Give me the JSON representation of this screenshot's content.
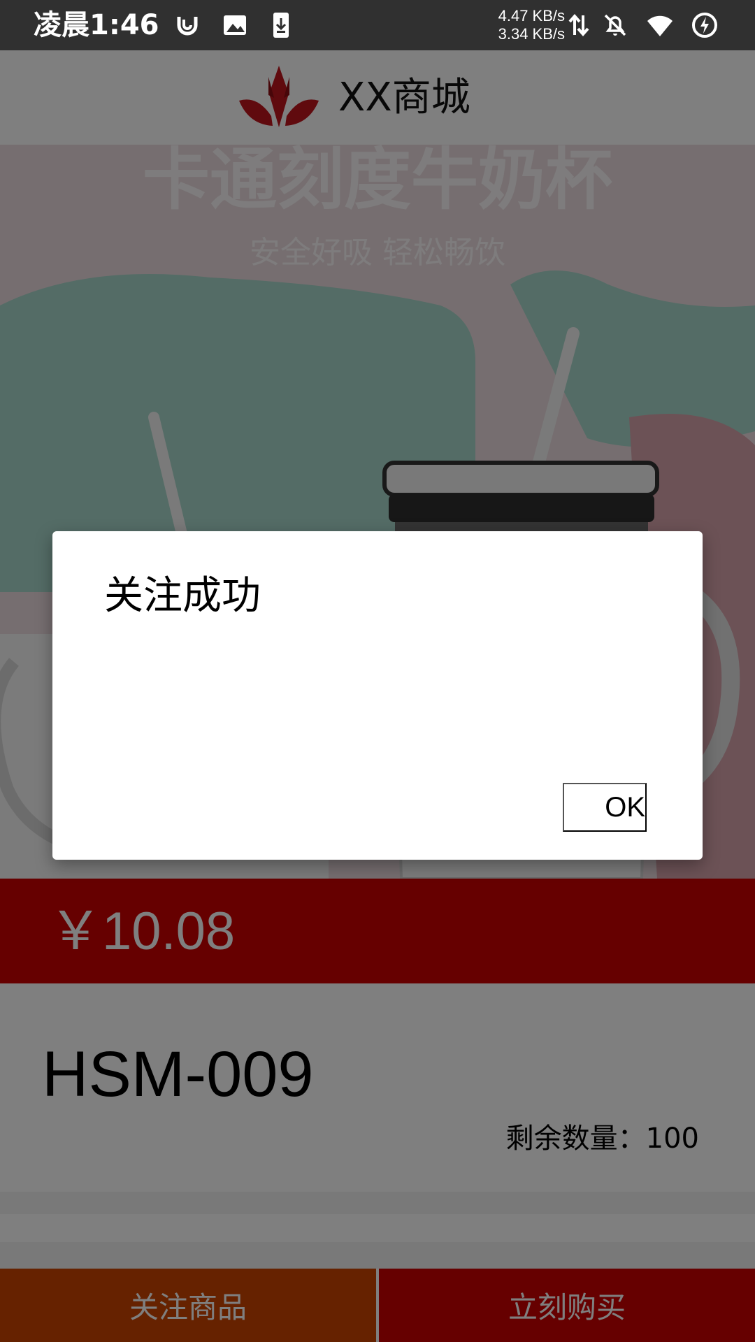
{
  "status_bar": {
    "time": "凌晨1:46",
    "net_speed_up": "4.47 KB/s",
    "net_speed_down": "3.34 KB/s",
    "icons": [
      "notification-app-icon",
      "gallery-icon",
      "download-icon",
      "data-transfer-icon",
      "bell-off-icon",
      "wifi-icon",
      "battery-charging-icon"
    ]
  },
  "header": {
    "title": "XX商城",
    "logo_color": "#c0141c"
  },
  "banner": {
    "headline": "卡通刻度牛奶杯",
    "subheadline": "安全好吸 轻松畅饮"
  },
  "product": {
    "price": "￥10.08",
    "code": "HSM-009",
    "stock_label": "剩余数量：100"
  },
  "actions": {
    "follow_label": "关注商品",
    "buy_label": "立刻购买",
    "follow_color": "#cc4400",
    "buy_color": "#cc0000"
  },
  "dialog": {
    "title": "关注成功",
    "ok_label": "OK"
  }
}
